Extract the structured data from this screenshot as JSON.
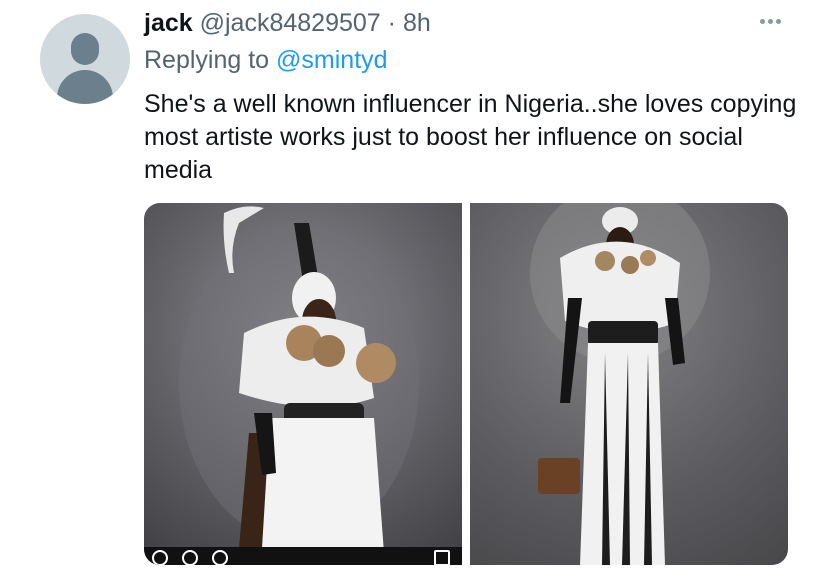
{
  "tweet": {
    "display_name": "jack",
    "handle": "@jack84829507",
    "separator": "·",
    "time": "8h",
    "reply_prefix": "Replying to",
    "reply_user": "@smintyd",
    "text": "She's a well known influencer in Nigeria..she loves copying most artiste works just to boost her influence on social media"
  },
  "icons": {
    "more": "more-horizontal-icon",
    "avatar": "default-avatar-icon"
  },
  "colors": {
    "name": "#0f1419",
    "secondary": "#536471",
    "link": "#1d9bf0"
  }
}
